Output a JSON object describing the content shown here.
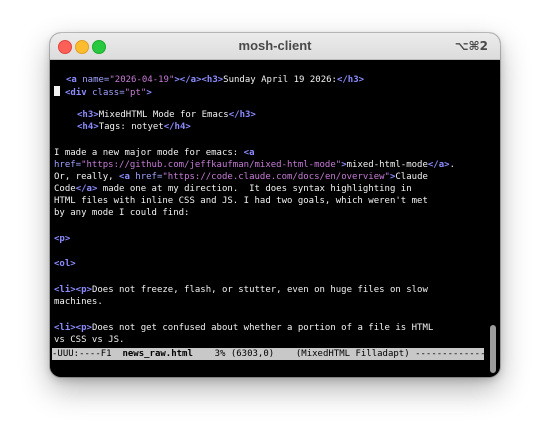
{
  "window": {
    "title": "mosh-client",
    "shortcut": "⌥⌘2"
  },
  "editor": {
    "l1": {
      "t1": "<a",
      "t2": " name=",
      "t3": "\"2026-04-19\"",
      "t4": "></a><h3>",
      "t5": "Sunday April 19 2026:",
      "t6": "</h3>"
    },
    "l2": {
      "t1": "<div",
      "t2": " class=",
      "t3": "\"pt\"",
      "t4": ">"
    },
    "l3": {
      "t1": "<h3>",
      "t2": "MixedHTML Mode for Emacs",
      "t3": "</h3>"
    },
    "l4": {
      "t1": "<h4>",
      "t2": "Tags: notyet",
      "t3": "</h4>"
    },
    "l5": {
      "t1": "I made a new major mode for emacs: ",
      "t2": "<a"
    },
    "l6": {
      "t1": "href=",
      "t2": "\"https://github.com/jeffkaufman/mixed-html-mode\"",
      "t3": ">",
      "t4": "mixed-html-mode",
      "t5": "</a>",
      "t6": "."
    },
    "l7": {
      "t1": "Or, really, ",
      "t2": "<a",
      "t3": " href=",
      "t4": "\"https://code.claude.com/docs/en/overview\"",
      "t5": ">",
      "t6": "Claude"
    },
    "l8": {
      "t1": "Code",
      "t2": "</a>",
      "t3": " made one at my direction.  It does syntax highlighting in"
    },
    "l9": "HTML files with inline CSS and JS. I had two goals, which weren't met",
    "l10": "by any mode I could find:",
    "l11": "<p>",
    "l12": "<ol>",
    "l13": {
      "t1": "<li><p>",
      "t2": "Does not freeze, flash, or stutter, even on huge files on slow"
    },
    "l14": "machines.",
    "l15": {
      "t1": "<li><p>",
      "t2": "Does not get confused about whether a portion of a file is HTML"
    },
    "l16": "vs CSS vs JS."
  },
  "modeline": {
    "prefix": "-UUU:----F1  ",
    "buffer": "news_raw.html",
    "position": "    3% (6303,0)    ",
    "mode": "(MixedHTML Filladapt)",
    "suffix": " ------------------------------"
  },
  "colors": {
    "tag": "#8c8cff",
    "attribute": "#a2a2ff",
    "string": "#c77bd8",
    "text": "#f2f2f2",
    "background": "#000000"
  }
}
